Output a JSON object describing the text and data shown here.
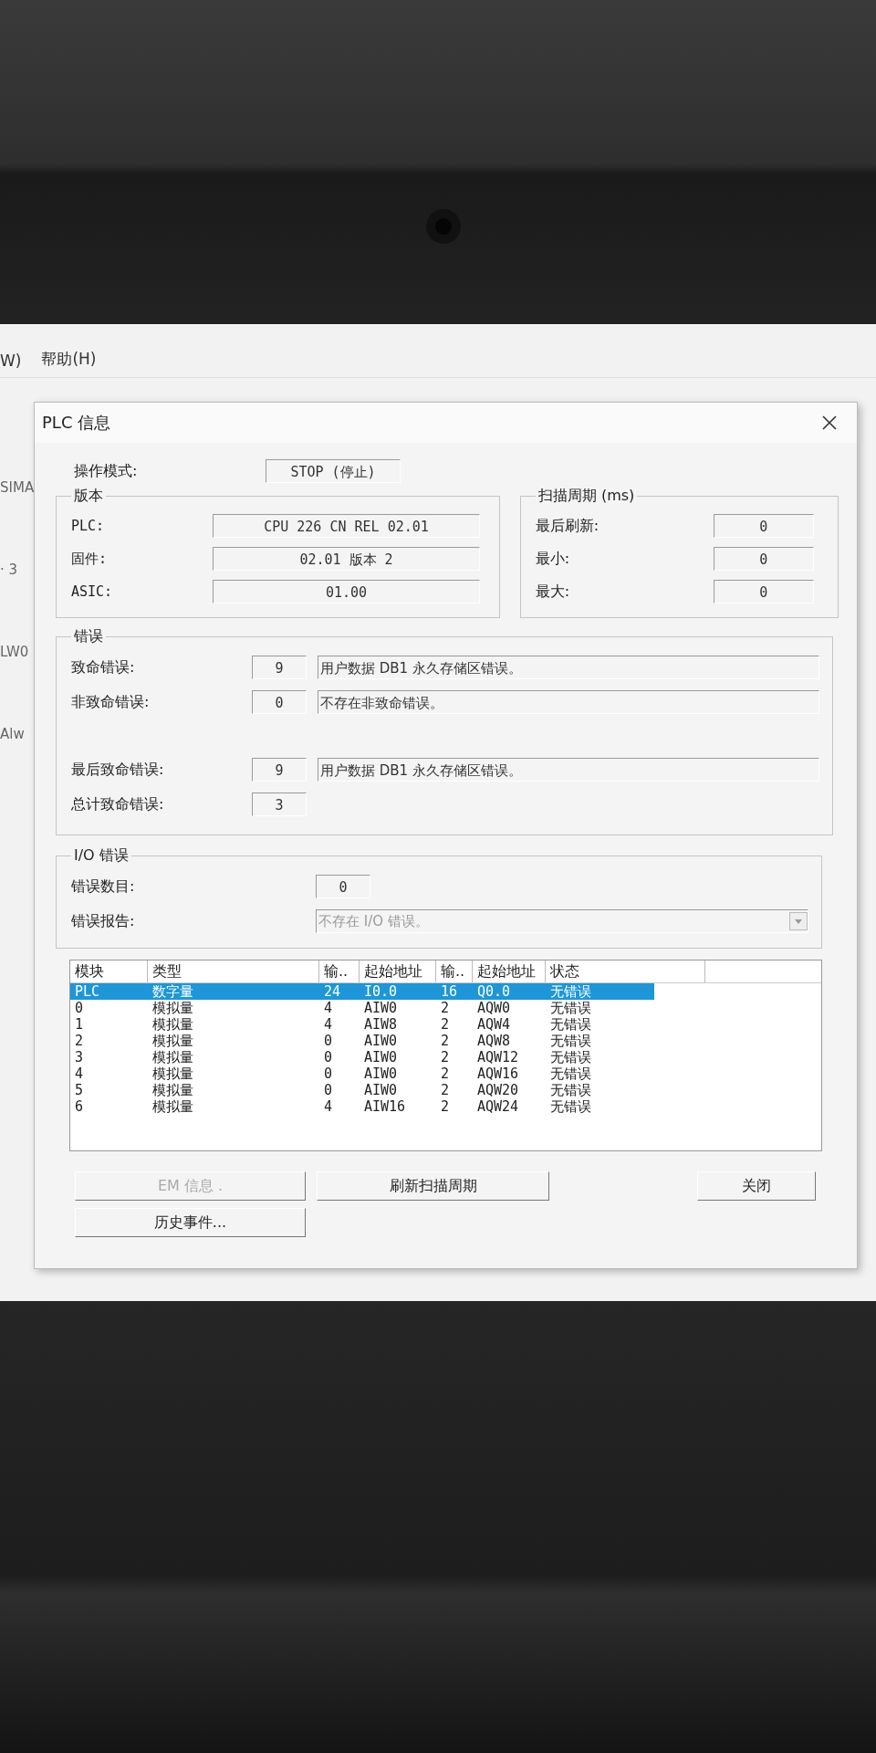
{
  "background_app": {
    "menu_items": [
      "W)",
      "帮助(H)"
    ],
    "side_texts": [
      "SIMA",
      "· 3",
      "LW0",
      "Alw"
    ]
  },
  "dialog": {
    "title": "PLC 信息",
    "mode": {
      "label": "操作模式:",
      "value": "STOP (停止)"
    },
    "version": {
      "title": "版本",
      "rows": [
        {
          "label": "PLC:",
          "value": "CPU 226 CN REL 02.01"
        },
        {
          "label": "固件:",
          "value": "02.01 版本 2"
        },
        {
          "label": "ASIC:",
          "value": "01.00"
        }
      ]
    },
    "scan_cycle": {
      "title": "扫描周期 (ms)",
      "rows": [
        {
          "label": "最后刷新:",
          "value": "0"
        },
        {
          "label": "最小:",
          "value": "0"
        },
        {
          "label": "最大:",
          "value": "0"
        }
      ]
    },
    "errors": {
      "title": "错误",
      "rows": [
        {
          "label": "致命错误:",
          "code": "9",
          "message": "用户数据 DB1 永久存储区错误。"
        },
        {
          "label": "非致命错误:",
          "code": "0",
          "message": "不存在非致命错误。"
        }
      ],
      "summary_rows": [
        {
          "label": "最后致命错误:",
          "code": "9",
          "message": "用户数据 DB1 永久存储区错误。"
        },
        {
          "label": "总计致命错误:",
          "code": "3"
        }
      ]
    },
    "io_errors": {
      "title": "I/O 错误",
      "count_label": "错误数目:",
      "count": "0",
      "report_label": "错误报告:",
      "report": "不存在 I/O 错误。"
    },
    "modules_table": {
      "columns": [
        "模块",
        "类型",
        "输..",
        "起始地址",
        "输..",
        "起始地址",
        "状态"
      ],
      "rows": [
        {
          "cells": [
            "PLC",
            "数字量",
            "24",
            "I0.0",
            "16",
            "Q0.0",
            "无错误"
          ],
          "selected": true
        },
        {
          "cells": [
            "0",
            "模拟量",
            "4",
            "AIW0",
            "2",
            "AQW0",
            "无错误"
          ],
          "selected": false
        },
        {
          "cells": [
            "1",
            "模拟量",
            "4",
            "AIW8",
            "2",
            "AQW4",
            "无错误"
          ],
          "selected": false
        },
        {
          "cells": [
            "2",
            "模拟量",
            "0",
            "AIW0",
            "2",
            "AQW8",
            "无错误"
          ],
          "selected": false
        },
        {
          "cells": [
            "3",
            "模拟量",
            "0",
            "AIW0",
            "2",
            "AQW12",
            "无错误"
          ],
          "selected": false
        },
        {
          "cells": [
            "4",
            "模拟量",
            "0",
            "AIW0",
            "2",
            "AQW16",
            "无错误"
          ],
          "selected": false
        },
        {
          "cells": [
            "5",
            "模拟量",
            "0",
            "AIW0",
            "2",
            "AQW20",
            "无错误"
          ],
          "selected": false
        },
        {
          "cells": [
            "6",
            "模拟量",
            "4",
            "AIW16",
            "2",
            "AQW24",
            "无错误"
          ],
          "selected": false
        }
      ]
    },
    "buttons": [
      {
        "label": "EM 信息 .",
        "disabled": true
      },
      {
        "label": "刷新扫描周期",
        "disabled": false
      },
      {
        "label": "关闭",
        "disabled": false
      },
      {
        "label": "历史事件...",
        "disabled": false
      }
    ]
  }
}
